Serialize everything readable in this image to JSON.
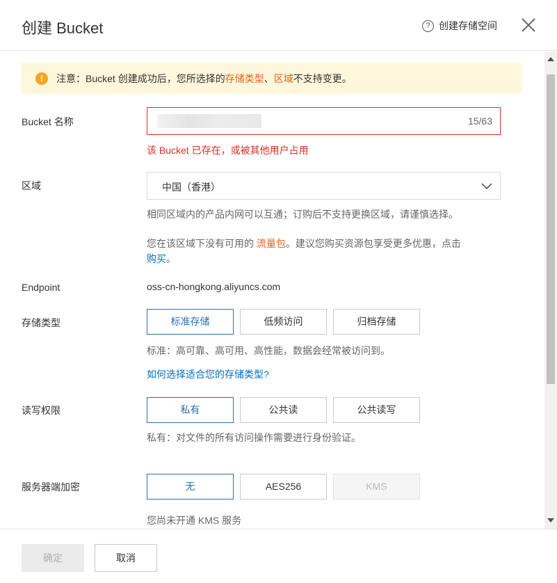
{
  "header": {
    "title": "创建 Bucket",
    "help_label": "创建存储空间"
  },
  "notice": {
    "prefix": "注意：Bucket 创建成功后，您所选择的 ",
    "link1": "存储类型",
    "sep": "、",
    "link2": "区域",
    "suffix": " 不支持变更。"
  },
  "bucket_name": {
    "label": "Bucket 名称",
    "count": "15/63",
    "error": "该 Bucket 已存在，或被其他用户占用"
  },
  "region": {
    "label": "区域",
    "value": "中国（香港）",
    "hint1": "相同区域内的产品内网可以互通；订购后不支持更换区域，请谨慎选择。",
    "hint2_prefix": "您在该区域下没有可用的 ",
    "hint2_link": "流量包",
    "hint2_suffix": "。建议您购买资源包享受更多优惠，点击",
    "hint2_buy": "购买",
    "hint2_end": "。"
  },
  "endpoint": {
    "label": "Endpoint",
    "value": "oss-cn-hongkong.aliyuncs.com"
  },
  "storage_class": {
    "label": "存储类型",
    "options": [
      "标准存储",
      "低频访问",
      "归档存储"
    ],
    "selected": "标准存储",
    "desc": "标准：高可靠、高可用、高性能，数据会经常被访问到。",
    "help_link": "如何选择适合您的存储类型?"
  },
  "acl": {
    "label": "读写权限",
    "options": [
      "私有",
      "公共读",
      "公共读写"
    ],
    "selected": "私有",
    "desc": "私有：对文件的所有访问操作需要进行身份验证。"
  },
  "encryption": {
    "label": "服务器端加密",
    "options": [
      "无",
      "AES256",
      "KMS"
    ],
    "selected": "无",
    "disabled": "KMS",
    "desc": "您尚未开通 KMS 服务"
  },
  "footer": {
    "confirm_label": "确定",
    "cancel_label": "取消"
  },
  "colors": {
    "accent": "#2d6fb0",
    "error": "#d93026",
    "highlight": "#e0641e",
    "link": "#0070cc",
    "notice_bg": "#fff7dc"
  }
}
